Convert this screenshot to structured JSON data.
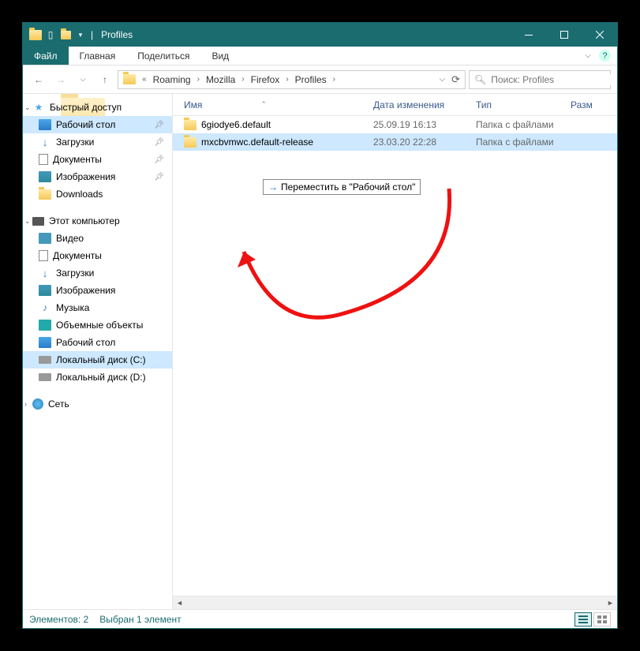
{
  "window": {
    "title": "Profiles"
  },
  "ribbon": {
    "file": "Файл",
    "tabs": [
      "Главная",
      "Поделиться",
      "Вид"
    ]
  },
  "breadcrumb": {
    "segments": [
      "Roaming",
      "Mozilla",
      "Firefox",
      "Profiles"
    ]
  },
  "search": {
    "placeholder": "Поиск: Profiles"
  },
  "sidebar": {
    "quick_access": "Быстрый доступ",
    "quick_items": [
      {
        "label": "Рабочий стол",
        "icon": "desktop",
        "pinned": true,
        "highlighted": true
      },
      {
        "label": "Загрузки",
        "icon": "download",
        "pinned": true
      },
      {
        "label": "Документы",
        "icon": "doc",
        "pinned": true
      },
      {
        "label": "Изображения",
        "icon": "img",
        "pinned": true
      },
      {
        "label": "Downloads",
        "icon": "folder",
        "pinned": false
      }
    ],
    "this_pc": "Этот компьютер",
    "pc_items": [
      {
        "label": "Видео",
        "icon": "video"
      },
      {
        "label": "Документы",
        "icon": "doc"
      },
      {
        "label": "Загрузки",
        "icon": "download"
      },
      {
        "label": "Изображения",
        "icon": "img"
      },
      {
        "label": "Музыка",
        "icon": "music"
      },
      {
        "label": "Объемные объекты",
        "icon": "3d"
      },
      {
        "label": "Рабочий стол",
        "icon": "desktop"
      },
      {
        "label": "Локальный диск (C:)",
        "icon": "disk",
        "selected": true
      },
      {
        "label": "Локальный диск (D:)",
        "icon": "disk"
      }
    ],
    "network": "Сеть"
  },
  "columns": {
    "name": "Имя",
    "date": "Дата изменения",
    "type": "Тип",
    "size": "Разм"
  },
  "files": [
    {
      "name": "6giodye6.default",
      "date": "25.09.19 16:13",
      "type": "Папка с файлами",
      "selected": false
    },
    {
      "name": "mxcbvmwc.default-release",
      "date": "23.03.20 22:28",
      "type": "Папка с файлами",
      "selected": true
    }
  ],
  "drag_tooltip": "Переместить в \"Рабочий стол\"",
  "status": {
    "count": "Элементов: 2",
    "selected": "Выбран 1 элемент"
  }
}
